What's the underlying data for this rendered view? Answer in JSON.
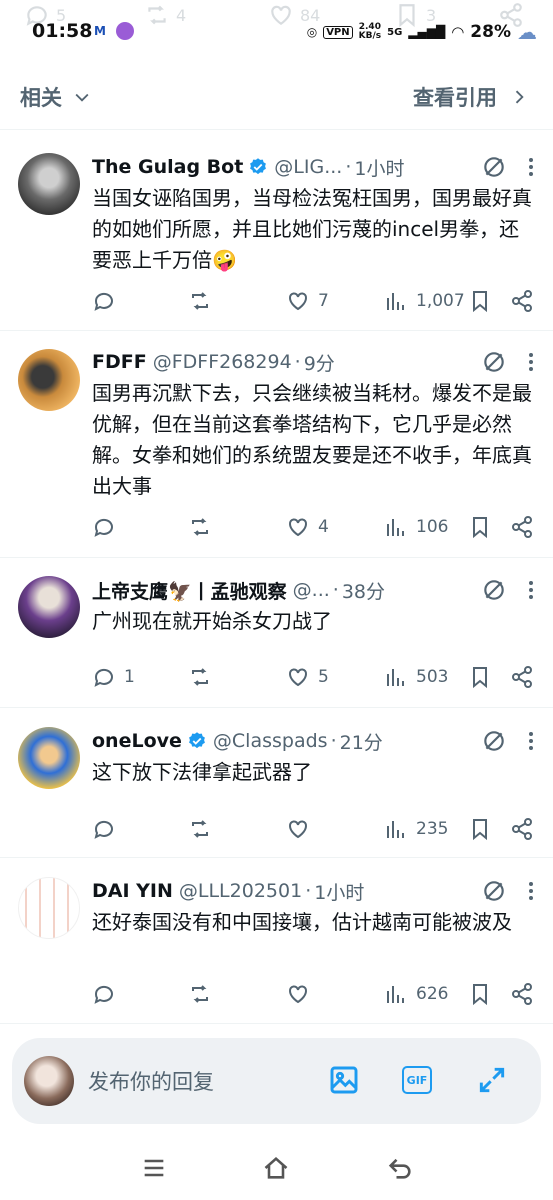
{
  "ghost_actions": [
    "5",
    "4",
    "84",
    "3"
  ],
  "status_bar": {
    "time": "01:58",
    "vpn": "VPN",
    "speed_value": "2.40",
    "speed_unit": "KB/s",
    "network": "5G",
    "battery": "28%"
  },
  "header": {
    "left_label": "相关",
    "right_label": "查看引用"
  },
  "tweets": [
    {
      "name": "The Gulag Bot",
      "verified": true,
      "handle": "@LIG...",
      "time": "1小时",
      "text": "当国女诬陷国男，当母检法冤枉国男，国男最好真的如她们所愿，并且比她们污蔑的incel男拳，还要恶上千万倍🤪",
      "replies": "",
      "retweets": "",
      "likes": "7",
      "views": "1,007"
    },
    {
      "name": "FDFF",
      "verified": false,
      "handle": "@FDFF268294",
      "time": "9分",
      "text": "国男再沉默下去，只会继续被当耗材。爆发不是最优解，但在当前这套拳塔结构下，它几乎是必然解。女拳和她们的系统盟友要是还不收手，年底真出大事",
      "replies": "",
      "retweets": "",
      "likes": "4",
      "views": "106"
    },
    {
      "name": "上帝支鹰🦅丨孟驰观察",
      "verified": false,
      "handle": "@...",
      "time": "38分",
      "text": "广州现在就开始杀女刀战了",
      "replies": "1",
      "retweets": "",
      "likes": "5",
      "views": "503"
    },
    {
      "name": "oneLove",
      "verified": true,
      "handle": "@Classpads",
      "time": "21分",
      "text": "这下放下法律拿起武器了",
      "replies": "",
      "retweets": "",
      "likes": "",
      "views": "235"
    },
    {
      "name": "DAI YIN",
      "verified": false,
      "handle": "@LLL202501",
      "time": "1小时",
      "text": "还好泰国没有和中国接壤，估计越南可能被波及",
      "replies": "",
      "retweets": "",
      "likes": "",
      "views": "626"
    }
  ],
  "reply_bar": {
    "placeholder": "发布你的回复",
    "gif_label": "GIF"
  },
  "colors": {
    "accent": "#1d9bf0",
    "secondary_text": "#536471",
    "verified": "#1d9bf0"
  }
}
